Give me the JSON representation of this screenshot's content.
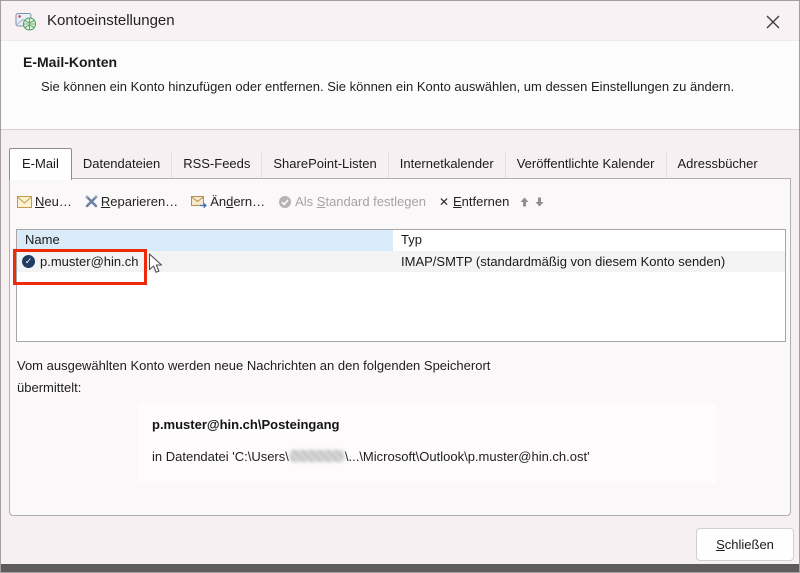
{
  "window": {
    "title": "Kontoeinstellungen",
    "close_glyph": "✕"
  },
  "header": {
    "title": "E-Mail-Konten",
    "description": "Sie können ein Konto hinzufügen oder entfernen. Sie können ein Konto auswählen, um dessen Einstellungen zu ändern."
  },
  "tabs": [
    {
      "label": "E-Mail",
      "active": true
    },
    {
      "label": "Datendateien"
    },
    {
      "label": "RSS-Feeds"
    },
    {
      "label": "SharePoint-Listen"
    },
    {
      "label": "Internetkalender"
    },
    {
      "label": "Veröffentlichte Kalender"
    },
    {
      "label": "Adressbücher"
    }
  ],
  "toolbar": {
    "new": {
      "pre": "",
      "u": "N",
      "post": "eu…"
    },
    "repair": {
      "pre": "",
      "u": "R",
      "post": "eparieren…"
    },
    "change": {
      "pre": "Än",
      "u": "d",
      "post": "ern…"
    },
    "set_default": {
      "pre": "Als ",
      "u": "S",
      "post": "tandard festlegen",
      "disabled": true
    },
    "remove": {
      "pre": "",
      "u": "E",
      "post": "ntfernen"
    },
    "remove_glyph": "✕"
  },
  "table": {
    "columns": {
      "name": "Name",
      "type": "Typ"
    },
    "row": {
      "name": "p.muster@hin.ch",
      "type": "IMAP/SMTP (standardmäßig von diesem Konto senden)",
      "default_check_glyph": "✓"
    }
  },
  "info": {
    "line1": "Vom ausgewählten Konto werden neue Nachrichten an den folgenden Speicherort",
    "line2": "übermittelt:",
    "delivery_path": "p.muster@hin.ch\\Posteingang",
    "datafile_prefix": "in Datendatei 'C:\\Users\\",
    "datafile_suffix": "\\...\\Microsoft\\Outlook\\p.muster@hin.ch.ost'"
  },
  "footer": {
    "close": {
      "pre": "",
      "u": "S",
      "post": "chließen"
    }
  },
  "colors": {
    "titlebar_bg": "#f8f2f5",
    "header_bg": "#fdfcfd",
    "main_bg": "#f6f0f3",
    "frame_bg": "#fbf8fa",
    "name_header_bg": "#d9eaf8",
    "row_bg": "#f4f3f3",
    "annotation_red": "#ee2b09",
    "disabled_text": "#a7a3a5"
  }
}
